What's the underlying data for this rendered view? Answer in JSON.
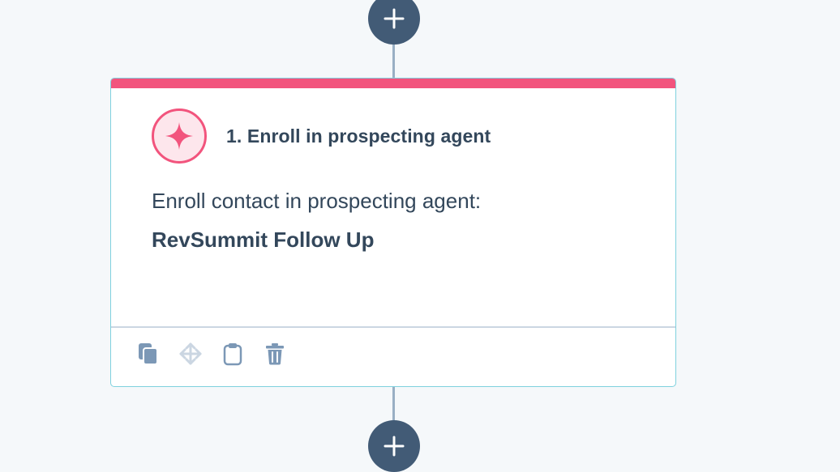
{
  "workflow": {
    "add_action_top": {
      "icon": "plus-icon"
    },
    "add_action_bottom": {
      "icon": "plus-icon"
    },
    "action_card": {
      "title": "1. Enroll in prospecting agent",
      "icon": "sparkle-icon",
      "description": "Enroll contact in prospecting agent:",
      "agent_name": "RevSummit Follow Up",
      "accent_color": "#f2547d",
      "toolbar": [
        {
          "name": "clone",
          "icon": "copy-icon"
        },
        {
          "name": "move",
          "icon": "move-icon"
        },
        {
          "name": "paste",
          "icon": "clipboard-icon"
        },
        {
          "name": "delete",
          "icon": "trash-icon"
        }
      ]
    }
  },
  "colors": {
    "background": "#f5f8fa",
    "button": "#425b76",
    "connector": "#99afc4",
    "card_border": "#7fd1de",
    "text": "#33475b",
    "icon_muted": "#7c98b6"
  }
}
